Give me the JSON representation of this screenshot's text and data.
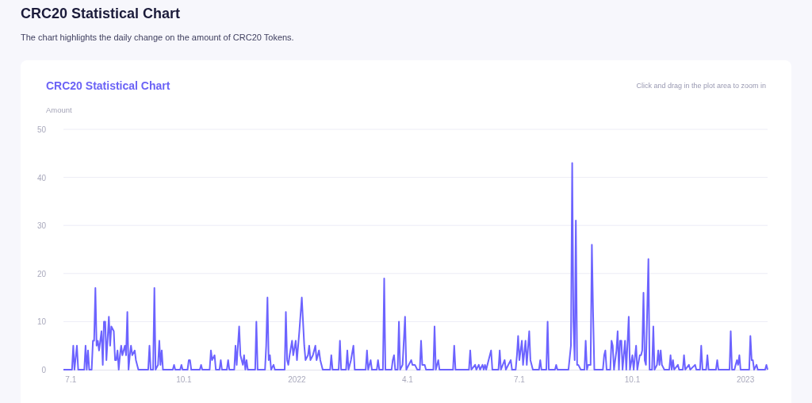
{
  "page": {
    "title": "CRC20 Statistical Chart",
    "description": "The chart highlights the daily change on the amount of CRC20 Tokens."
  },
  "card": {
    "title": "CRC20 Statistical Chart",
    "hint": "Click and drag in the plot area to zoom in",
    "chart_data": {
      "type": "line",
      "grid": true,
      "ylabel": "Amount",
      "ylim": [
        0,
        50
      ],
      "xlim": [
        "2021-06-25",
        "2023-01-19"
      ],
      "yticks": [
        0,
        10,
        20,
        30,
        40,
        50
      ],
      "xticks": [
        {
          "value": "2021-07-01",
          "label": "7.1"
        },
        {
          "value": "2021-10-01",
          "label": "10.1"
        },
        {
          "value": "2022-01-01",
          "label": "2022"
        },
        {
          "value": "2022-04-01",
          "label": "4.1"
        },
        {
          "value": "2022-07-01",
          "label": "7.1"
        },
        {
          "value": "2022-10-01",
          "label": "10.1"
        },
        {
          "value": "2023-01-01",
          "label": "2023"
        }
      ],
      "x": [
        "2021-06-25",
        "2021-07-02",
        "2021-07-03",
        "2021-07-04",
        "2021-07-06",
        "2021-07-07",
        "2021-07-12",
        "2021-07-13",
        "2021-07-14",
        "2021-07-15",
        "2021-07-16",
        "2021-07-18",
        "2021-07-19",
        "2021-07-20",
        "2021-07-21",
        "2021-07-22",
        "2021-07-23",
        "2021-07-24",
        "2021-07-26",
        "2021-07-27",
        "2021-07-28",
        "2021-07-29",
        "2021-07-30",
        "2021-08-01",
        "2021-08-02",
        "2021-08-03",
        "2021-08-05",
        "2021-08-06",
        "2021-08-07",
        "2021-08-08",
        "2021-08-09",
        "2021-08-10",
        "2021-08-11",
        "2021-08-12",
        "2021-08-14",
        "2021-08-15",
        "2021-08-16",
        "2021-08-17",
        "2021-08-18",
        "2021-08-19",
        "2021-08-20",
        "2021-08-22",
        "2021-08-23",
        "2021-08-25",
        "2021-09-02",
        "2021-09-03",
        "2021-09-04",
        "2021-09-06",
        "2021-09-07",
        "2021-09-08",
        "2021-09-10",
        "2021-09-11",
        "2021-09-12",
        "2021-09-13",
        "2021-09-14",
        "2021-09-22",
        "2021-09-23",
        "2021-09-24",
        "2021-09-28",
        "2021-09-29",
        "2021-09-30",
        "2021-10-04",
        "2021-10-05",
        "2021-10-06",
        "2021-10-07",
        "2021-10-14",
        "2021-10-15",
        "2021-10-16",
        "2021-10-22",
        "2021-10-23",
        "2021-10-24",
        "2021-10-26",
        "2021-10-27",
        "2021-10-30",
        "2021-10-31",
        "2021-11-01",
        "2021-11-05",
        "2021-11-06",
        "2021-11-07",
        "2021-11-11",
        "2021-11-12",
        "2021-11-13",
        "2021-11-15",
        "2021-11-16",
        "2021-11-18",
        "2021-11-19",
        "2021-11-20",
        "2021-11-21",
        "2021-11-22",
        "2021-11-28",
        "2021-11-29",
        "2021-11-30",
        "2021-12-06",
        "2021-12-07",
        "2021-12-08",
        "2021-12-09",
        "2021-12-10",
        "2021-12-11",
        "2021-12-13",
        "2021-12-14",
        "2021-12-22",
        "2021-12-23",
        "2021-12-24",
        "2021-12-25",
        "2021-12-26",
        "2021-12-28",
        "2021-12-29",
        "2021-12-31",
        "2022-01-01",
        "2022-01-03",
        "2022-01-05",
        "2022-01-07",
        "2022-01-08",
        "2022-01-10",
        "2022-01-11",
        "2022-01-12",
        "2022-01-14",
        "2022-01-16",
        "2022-01-17",
        "2022-01-19",
        "2022-01-20",
        "2022-01-22",
        "2022-01-28",
        "2022-01-29",
        "2022-01-30",
        "2022-02-04",
        "2022-02-05",
        "2022-02-06",
        "2022-02-10",
        "2022-02-11",
        "2022-02-12",
        "2022-02-14",
        "2022-02-16",
        "2022-02-17",
        "2022-02-26",
        "2022-02-27",
        "2022-02-28",
        "2022-03-02",
        "2022-03-03",
        "2022-03-07",
        "2022-03-08",
        "2022-03-09",
        "2022-03-12",
        "2022-03-13",
        "2022-03-14",
        "2022-03-19",
        "2022-03-20",
        "2022-03-21",
        "2022-03-22",
        "2022-03-24",
        "2022-03-25",
        "2022-03-26",
        "2022-03-28",
        "2022-03-30",
        "2022-03-31",
        "2022-04-02",
        "2022-04-04",
        "2022-04-05",
        "2022-04-07",
        "2022-04-09",
        "2022-04-11",
        "2022-04-12",
        "2022-04-13",
        "2022-04-15",
        "2022-04-16",
        "2022-04-22",
        "2022-04-23",
        "2022-04-24",
        "2022-04-26",
        "2022-04-27",
        "2022-05-08",
        "2022-05-09",
        "2022-05-10",
        "2022-05-21",
        "2022-05-22",
        "2022-05-23",
        "2022-05-26",
        "2022-05-27",
        "2022-05-29",
        "2022-05-30",
        "2022-06-01",
        "2022-06-02",
        "2022-06-03",
        "2022-06-04",
        "2022-06-08",
        "2022-06-09",
        "2022-06-14",
        "2022-06-15",
        "2022-06-16",
        "2022-06-19",
        "2022-06-20",
        "2022-06-24",
        "2022-06-25",
        "2022-06-28",
        "2022-06-29",
        "2022-06-30",
        "2022-07-01",
        "2022-07-03",
        "2022-07-04",
        "2022-07-06",
        "2022-07-07",
        "2022-07-09",
        "2022-07-10",
        "2022-07-12",
        "2022-07-17",
        "2022-07-18",
        "2022-07-19",
        "2022-07-23",
        "2022-07-24",
        "2022-07-25",
        "2022-07-30",
        "2022-07-31",
        "2022-08-01",
        "2022-08-10",
        "2022-08-12",
        "2022-08-13",
        "2022-08-14",
        "2022-08-15",
        "2022-08-16",
        "2022-08-17",
        "2022-08-18",
        "2022-08-20",
        "2022-08-23",
        "2022-08-24",
        "2022-08-25",
        "2022-08-26",
        "2022-08-28",
        "2022-08-29",
        "2022-08-30",
        "2022-08-31",
        "2022-09-07",
        "2022-09-08",
        "2022-09-09",
        "2022-09-10",
        "2022-09-13",
        "2022-09-14",
        "2022-09-15",
        "2022-09-16",
        "2022-09-18",
        "2022-09-19",
        "2022-09-20",
        "2022-09-21",
        "2022-09-22",
        "2022-09-23",
        "2022-09-25",
        "2022-09-26",
        "2022-09-28",
        "2022-09-29",
        "2022-10-01",
        "2022-10-02",
        "2022-10-04",
        "2022-10-05",
        "2022-10-07",
        "2022-10-08",
        "2022-10-09",
        "2022-10-10",
        "2022-10-11",
        "2022-10-12",
        "2022-10-14",
        "2022-10-15",
        "2022-10-17",
        "2022-10-18",
        "2022-10-19",
        "2022-10-21",
        "2022-10-22",
        "2022-10-23",
        "2022-10-24",
        "2022-10-25",
        "2022-10-27",
        "2022-10-31",
        "2022-11-01",
        "2022-11-02",
        "2022-11-03",
        "2022-11-04",
        "2022-11-07",
        "2022-11-08",
        "2022-11-11",
        "2022-11-12",
        "2022-11-13",
        "2022-11-16",
        "2022-11-17",
        "2022-11-21",
        "2022-11-22",
        "2022-11-25",
        "2022-11-26",
        "2022-11-27",
        "2022-11-30",
        "2022-12-01",
        "2022-12-02",
        "2022-12-08",
        "2022-12-09",
        "2022-12-10",
        "2022-12-19",
        "2022-12-20",
        "2022-12-21",
        "2022-12-23",
        "2022-12-24",
        "2022-12-25",
        "2022-12-26",
        "2022-12-27",
        "2022-12-28",
        "2023-01-04",
        "2023-01-05",
        "2023-01-06",
        "2023-01-07",
        "2023-01-08",
        "2023-01-10",
        "2023-01-11",
        "2023-01-17",
        "2023-01-18",
        "2023-01-19"
      ],
      "series": [
        {
          "color": "#6c63ff",
          "values": [
            0,
            0,
            5,
            0,
            5,
            0,
            0,
            5,
            0,
            4,
            0,
            0,
            6,
            6,
            17,
            5,
            6,
            4,
            8,
            1,
            10,
            10,
            2,
            11,
            5,
            9,
            8,
            2,
            2,
            4,
            0,
            3,
            5,
            3,
            5,
            3,
            12,
            0,
            3,
            5,
            3,
            4,
            2,
            0,
            0,
            5,
            0,
            0,
            17,
            0,
            1,
            6,
            1,
            4,
            0,
            0,
            1,
            0,
            0,
            1,
            0,
            0,
            2,
            2,
            0,
            0,
            1,
            0,
            0,
            4,
            2,
            3,
            0,
            0,
            2,
            0,
            0,
            2,
            0,
            0,
            5,
            1,
            9,
            3,
            1,
            3,
            0,
            2,
            0,
            0,
            10,
            0,
            0,
            5,
            15,
            2,
            3,
            0,
            1,
            0,
            0,
            12,
            2,
            1,
            3,
            6,
            3,
            6,
            2,
            8,
            15,
            5,
            2,
            3,
            5,
            2,
            3,
            5,
            2,
            4,
            2,
            0,
            0,
            3,
            0,
            0,
            6,
            0,
            0,
            4,
            0,
            2,
            5,
            0,
            0,
            4,
            0,
            2,
            0,
            0,
            2,
            0,
            0,
            19,
            0,
            0,
            2,
            3,
            0,
            0,
            10,
            0,
            1,
            11,
            0,
            1,
            2,
            1,
            1,
            0,
            0,
            6,
            1,
            1,
            0,
            0,
            9,
            0,
            2,
            0,
            0,
            5,
            0,
            0,
            4,
            0,
            1,
            0,
            1,
            0,
            1,
            0,
            1,
            0,
            4,
            0,
            0,
            4,
            0,
            2,
            0,
            2,
            0,
            0,
            3,
            7,
            2,
            6,
            1,
            6,
            1,
            8,
            2,
            0,
            0,
            2,
            0,
            0,
            10,
            0,
            0,
            1,
            0,
            0,
            5,
            43,
            10,
            2,
            31,
            1,
            1,
            0,
            0,
            6,
            0,
            1,
            1,
            26,
            12,
            0,
            0,
            3,
            4,
            0,
            0,
            6,
            5,
            0,
            4,
            8,
            0,
            6,
            6,
            0,
            6,
            0,
            11,
            0,
            3,
            0,
            5,
            0,
            3,
            3,
            4,
            16,
            2,
            1,
            23,
            0,
            0,
            9,
            0,
            1,
            4,
            1,
            4,
            1,
            0,
            0,
            3,
            0,
            2,
            0,
            1,
            0,
            0,
            3,
            0,
            1,
            0,
            1,
            0,
            0,
            5,
            0,
            0,
            3,
            0,
            0,
            2,
            0,
            0,
            8,
            0,
            0,
            1,
            2,
            1,
            3,
            0,
            0,
            7,
            2,
            2,
            0,
            1,
            0,
            0,
            1,
            0
          ]
        }
      ]
    }
  }
}
